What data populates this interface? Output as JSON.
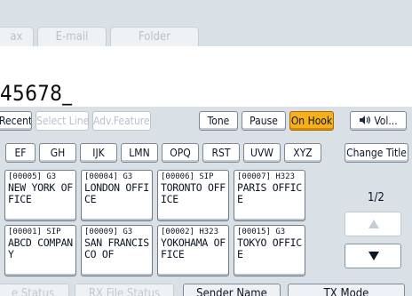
{
  "tabs": {
    "fax": "ax",
    "email": "E-mail",
    "folder": "Folder"
  },
  "destination": {
    "number": "45678_"
  },
  "toolbar": {
    "recent": "Recent",
    "select_line": "Select Line",
    "adv_features": "Adv.Features",
    "tone": "Tone",
    "pause": "Pause",
    "on_hook": "On Hook",
    "volume": "Vol..."
  },
  "title_keys": [
    "EF",
    "GH",
    "IJK",
    "LMN",
    "OPQ",
    "RST",
    "UVW",
    "XYZ"
  ],
  "change_title": "Change Title",
  "entries": [
    {
      "header": "[00005] G3",
      "name": "NEW YORK OFFICE"
    },
    {
      "header": "[00004] G3",
      "name": "LONDON OFFICE"
    },
    {
      "header": "[00006] SIP",
      "name": "TORONTO OFFICE"
    },
    {
      "header": "[00007] H323",
      "name": "PARIS OFFICE"
    },
    {
      "header": "[00001] SIP",
      "name": "ABCD COMPANY"
    },
    {
      "header": "[00009] G3",
      "name": "SAN FRANCISCO OF"
    },
    {
      "header": "[00002] H323",
      "name": "YOKOHAMA OFFICE"
    },
    {
      "header": "[00015] G3",
      "name": "TOKYO OFFICE"
    }
  ],
  "pagination": {
    "page": "1/2"
  },
  "bottom": {
    "status": "e Status",
    "rx_file_status": "RX File Status",
    "sender_name": "Sender Name",
    "tx_mode": "TX Mode"
  }
}
